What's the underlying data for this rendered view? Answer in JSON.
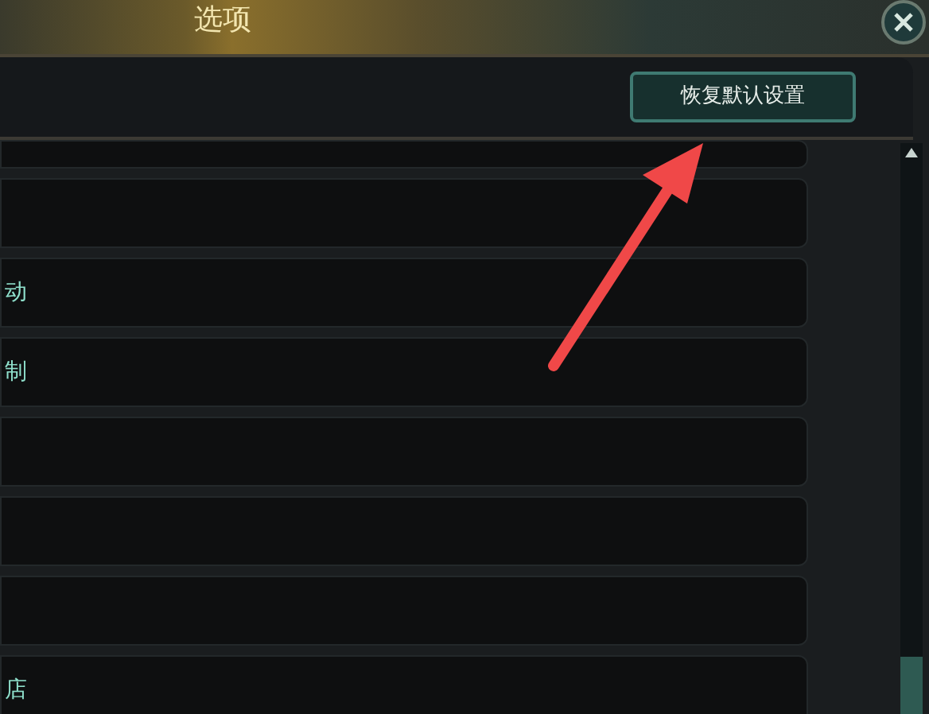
{
  "window": {
    "title": "选项"
  },
  "toolbar": {
    "reset_button": "恢复默认设置"
  },
  "rows": [
    {},
    {},
    {
      "label": "动"
    },
    {
      "label": "制"
    },
    {},
    {},
    {},
    {
      "label": "店"
    }
  ]
}
